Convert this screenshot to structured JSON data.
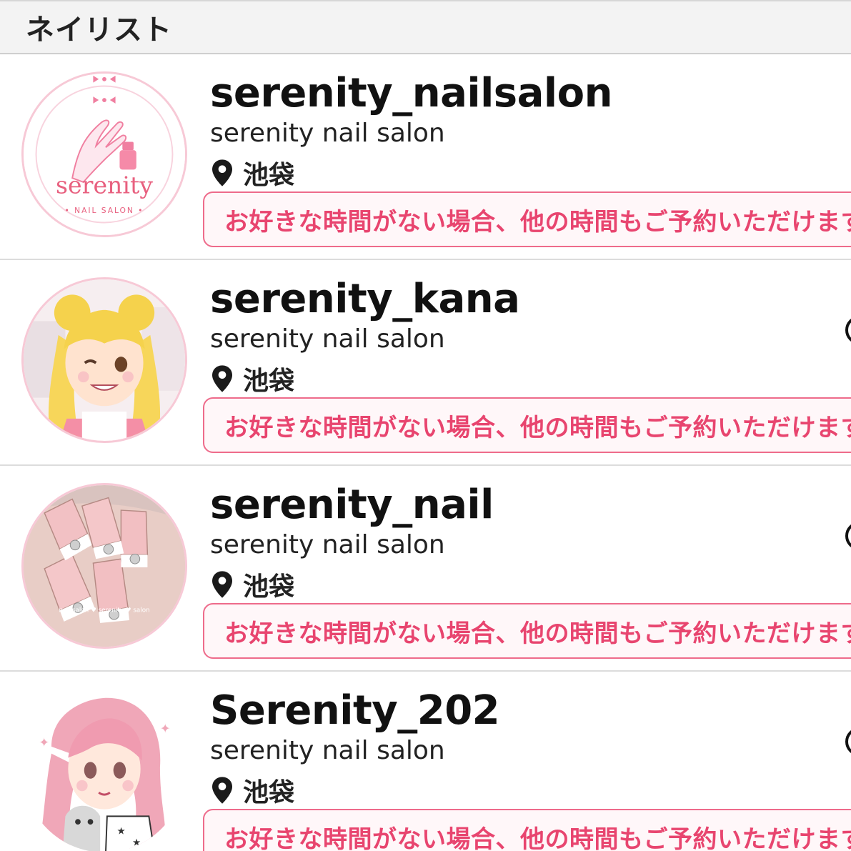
{
  "header": {
    "title": "ネイリスト"
  },
  "nailists": [
    {
      "username": "serenity_nailsalon",
      "salon": "serenity nail salon",
      "location": "池袋",
      "notice": "お好きな時間がない場合、他の時間もご予約いただけます",
      "avatar": {
        "kind": "logo",
        "logo_text": "serenity",
        "logo_sub": "NAIL SALON"
      }
    },
    {
      "username": "serenity_kana",
      "salon": "serenity nail salon",
      "location": "池袋",
      "notice": "お好きな時間がない場合、他の時間もご予約いただけます",
      "avatar": {
        "kind": "anime-blonde-girl"
      }
    },
    {
      "username": "serenity_nail",
      "salon": "serenity nail salon",
      "location": "池袋",
      "notice": "お好きな時間がない場合、他の時間もご予約いただけます",
      "avatar": {
        "kind": "nail-photo",
        "watermark": "nail salon ♥ serenity ♥ salon"
      }
    },
    {
      "username": "Serenity_202",
      "salon": "serenity nail salon",
      "location": "池袋",
      "notice": "お好きな時間がない場合、他の時間もご予約いただけます",
      "avatar": {
        "kind": "anime-pink-girl"
      }
    }
  ],
  "colors": {
    "accent": "#e8456f",
    "notice_border": "#ee6b8b",
    "avatar_border": "#f7c9d6",
    "header_bg": "#f3f3f3"
  },
  "icons": {
    "location": "map-pin-icon",
    "edge": "circle-icon"
  }
}
